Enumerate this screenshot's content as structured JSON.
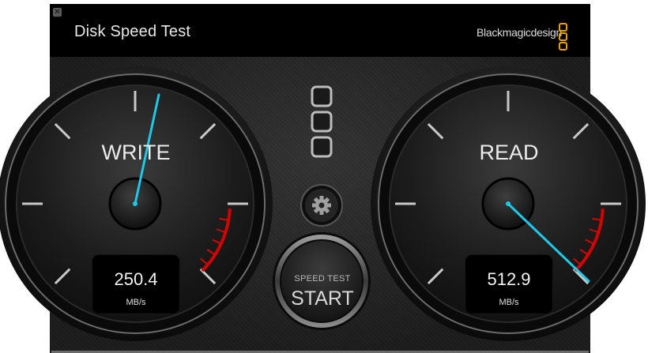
{
  "window": {
    "title": "Disk Speed Test",
    "close_glyph": "✕",
    "brand_text": "Blackmagicdesign",
    "brand_color": "#e8a100"
  },
  "write_gauge": {
    "label": "WRITE",
    "value": "250.4",
    "unit": "MB/s",
    "needle_color": "#1ec8e8"
  },
  "read_gauge": {
    "label": "READ",
    "value": "512.9",
    "unit": "MB/s",
    "needle_color": "#1ec8e8"
  },
  "controls": {
    "start_caption": "SPEED TEST",
    "start_label": "START",
    "settings_icon": "gear-icon",
    "layout_icon": "three-squares-icon"
  },
  "redline_color": "#d40000"
}
